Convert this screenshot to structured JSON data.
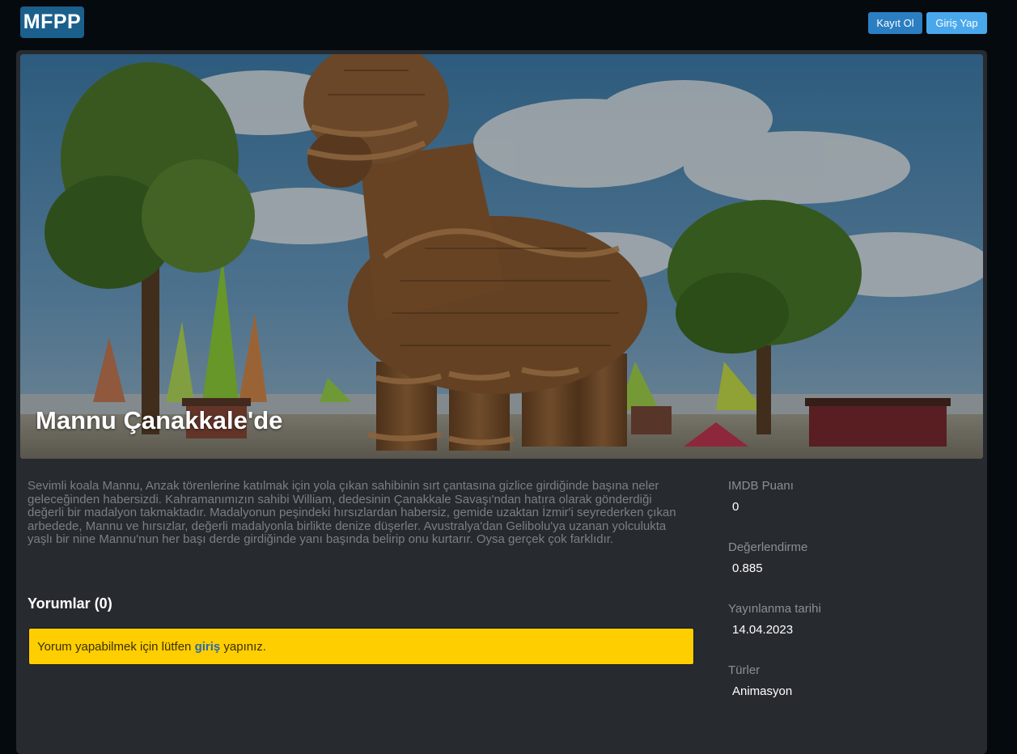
{
  "navbar": {
    "logo": "MFPP",
    "register_label": "Kayıt Ol",
    "login_label": "Giriş Yap"
  },
  "movie": {
    "title": "Mannu Çanakkale'de",
    "description": "Sevimli koala Mannu, Anzak törenlerine katılmak için yola çıkan sahibinin sırt çantasına gizlice girdiğinde başına neler geleceğinden habersizdi. Kahramanımızın sahibi William, dedesinin Çanakkale Savaşı'ndan hatıra olarak gönderdiği değerli bir madalyon takmaktadır. Madalyonun peşindeki hırsızlardan habersiz, gemide uzaktan İzmir'i seyrederken çıkan arbedede, Mannu ve hırsızlar, değerli madalyonla birlikte denize düşerler. Avustralya'dan Gelibolu'ya uzanan yolculukta yaşlı bir nine Mannu'nun her başı derde girdiğinde yanı başında belirip onu kurtarır. Oysa gerçek çok farklıdır."
  },
  "comments": {
    "heading": "Yorumlar (0)",
    "alert_prefix": "Yorum yapabilmek için lütfen",
    "alert_link": "giriş",
    "alert_suffix": "yapınız."
  },
  "details": {
    "imdb_label": "IMDB Puanı",
    "imdb_value": "0",
    "rating_label": "Değerlendirme",
    "rating_value": "0.885",
    "release_label": "Yayınlanma tarihi",
    "release_value": "14.04.2023",
    "genres_label": "Türler",
    "genres_value": "Animasyon"
  },
  "colors": {
    "logo_bg": "#1b5f8c",
    "register_bg": "#2b7ec2",
    "login_bg": "#49a8ec",
    "alert_bg": "#ffce00",
    "card_bg": "#272b30"
  }
}
